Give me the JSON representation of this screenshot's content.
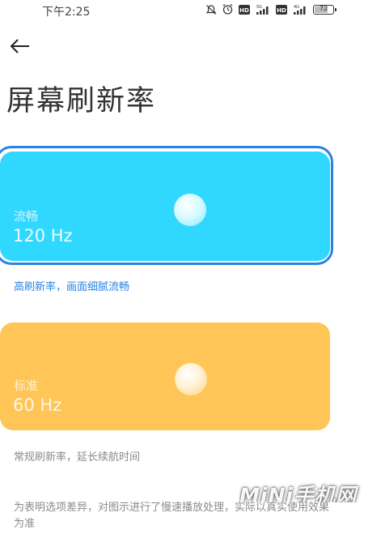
{
  "status_bar": {
    "time": "下午2:25",
    "icons": [
      "mute-icon",
      "alarm-icon",
      "hd-icon",
      "signal-5g-icon",
      "hd-icon",
      "signal-4g-icon",
      "battery-icon"
    ],
    "battery_level": "72",
    "network_1": "5G",
    "network_2": "4G"
  },
  "header": {
    "back_icon": "arrow-left-icon",
    "title": "屏幕刷新率"
  },
  "options": [
    {
      "label": "流畅",
      "value": "120 Hz",
      "description": "高刷新率，画面细腻流畅",
      "selected": true,
      "color": "#30d8ff"
    },
    {
      "label": "标准",
      "value": "60 Hz",
      "description": "常规刷新率，延长续航时间",
      "selected": false,
      "color": "#ffc657"
    }
  ],
  "note": "为表明选项差异，对图示进行了慢速播放处理，实际以真实使用效果为准",
  "watermark": "MiNi手机网",
  "colors": {
    "accent": "#2a83e3",
    "muted_text": "#8a8a8a"
  }
}
